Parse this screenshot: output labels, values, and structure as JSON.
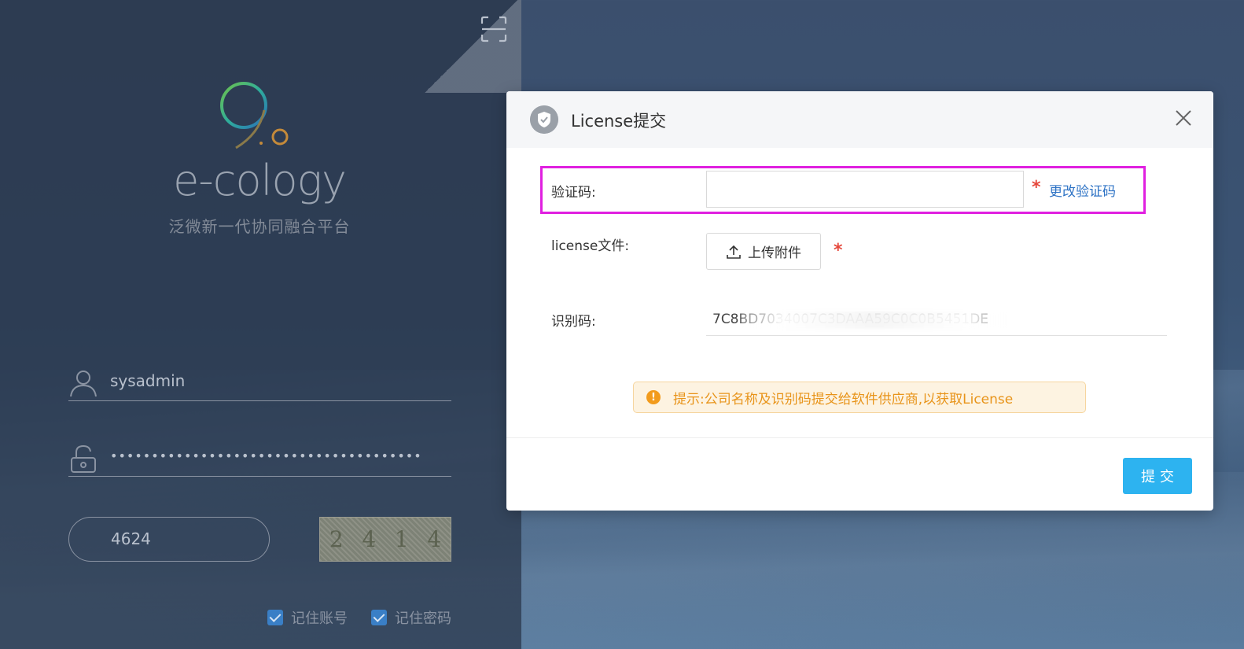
{
  "login": {
    "brand_name": "e-cology",
    "brand_subtitle": "泛微新一代协同融合平台",
    "username": "sysadmin",
    "password_mask": "••••••••••••••••••••••••••••••••••••••",
    "captcha_value": "4624",
    "captcha_image_chars": [
      "2",
      "4",
      "1",
      "4"
    ],
    "remember_account_label": "记住账号",
    "remember_password_label": "记住密码",
    "remember_account_checked": true,
    "remember_password_checked": true
  },
  "modal": {
    "title": "License提交",
    "captcha_label": "验证码:",
    "captcha_input_value": "",
    "change_captcha_link": "更改验证码",
    "license_file_label": "license文件:",
    "upload_button_label": "上传附件",
    "identification_label": "识别码:",
    "identification_value": "7C8BD7034007C3DAAA59C0C0B5451DE",
    "required_mark": "*",
    "tip_text": "提示:公司名称及识别码提交给软件供应商,以获取License",
    "submit_label": "提交"
  },
  "colors": {
    "accent": "#2db3f0",
    "link": "#2e73c5",
    "required": "#e5483c",
    "tip_text": "#e8941a",
    "highlight": "#e020e0"
  },
  "icons": {
    "scan": "fullscreen-scan-icon",
    "user": "user-icon",
    "lock": "unlock-icon",
    "shield": "shield-check-icon",
    "close": "close-icon",
    "upload": "upload-icon",
    "warning": "warning-icon"
  }
}
